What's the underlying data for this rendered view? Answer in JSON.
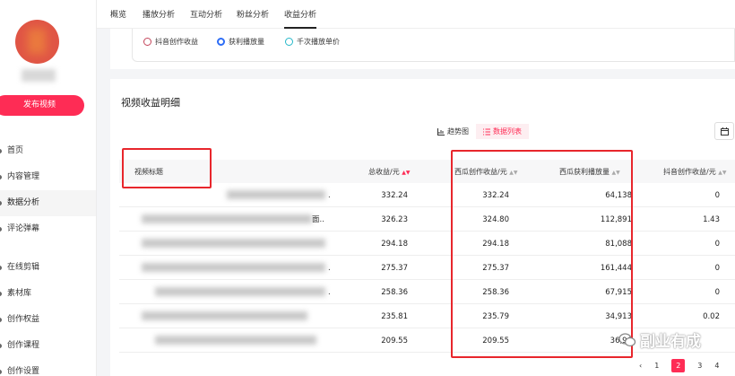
{
  "sidebar": {
    "publish_label": "发布视频",
    "nav": [
      "首页",
      "内容管理",
      "数据分析",
      "评论弹幕",
      "在线剪辑",
      "素材库",
      "创作权益",
      "创作课程",
      "创作设置"
    ],
    "active_index": 2
  },
  "tabs": [
    "概览",
    "播放分析",
    "互动分析",
    "粉丝分析",
    "收益分析"
  ],
  "active_tab": 4,
  "filter": {
    "options": [
      "抖音创作收益",
      "获利播放量",
      "千次播放单价"
    ],
    "selected": 1
  },
  "section_title": "视频收益明细",
  "view_toggle": {
    "chart_label": "趋势图",
    "list_label": "数据列表"
  },
  "table": {
    "headers": [
      "视频标题",
      "总收益/元",
      "西瓜创作收益/元",
      "西瓜获利播放量",
      "抖音创作收益/元"
    ],
    "rows": [
      {
        "title_suffix": ".",
        "total": "332.24",
        "xigua": "332.24",
        "plays": "64,138",
        "douyin": "0"
      },
      {
        "title_suffix": "面..",
        "total": "326.23",
        "xigua": "324.80",
        "plays": "112,891",
        "douyin": "1.43"
      },
      {
        "title_suffix": "",
        "total": "294.18",
        "xigua": "294.18",
        "plays": "81,088",
        "douyin": "0"
      },
      {
        "title_suffix": ".",
        "total": "275.37",
        "xigua": "275.37",
        "plays": "161,444",
        "douyin": "0"
      },
      {
        "title_suffix": ".",
        "total": "258.36",
        "xigua": "258.36",
        "plays": "67,915",
        "douyin": "0"
      },
      {
        "title_suffix": "",
        "total": "235.81",
        "xigua": "235.79",
        "plays": "34,913",
        "douyin": "0.02"
      },
      {
        "title_suffix": "",
        "total": "209.55",
        "xigua": "209.55",
        "plays": "36,96",
        "douyin": ""
      }
    ]
  },
  "pagination": {
    "prev": "‹",
    "pages": [
      "1",
      "2",
      "3",
      "4"
    ],
    "active": "2"
  },
  "watermark": "副业有成",
  "colors": {
    "accent": "#fe2c55",
    "highlight_box": "#e8262c",
    "radio_selected": "#2d6df6"
  }
}
